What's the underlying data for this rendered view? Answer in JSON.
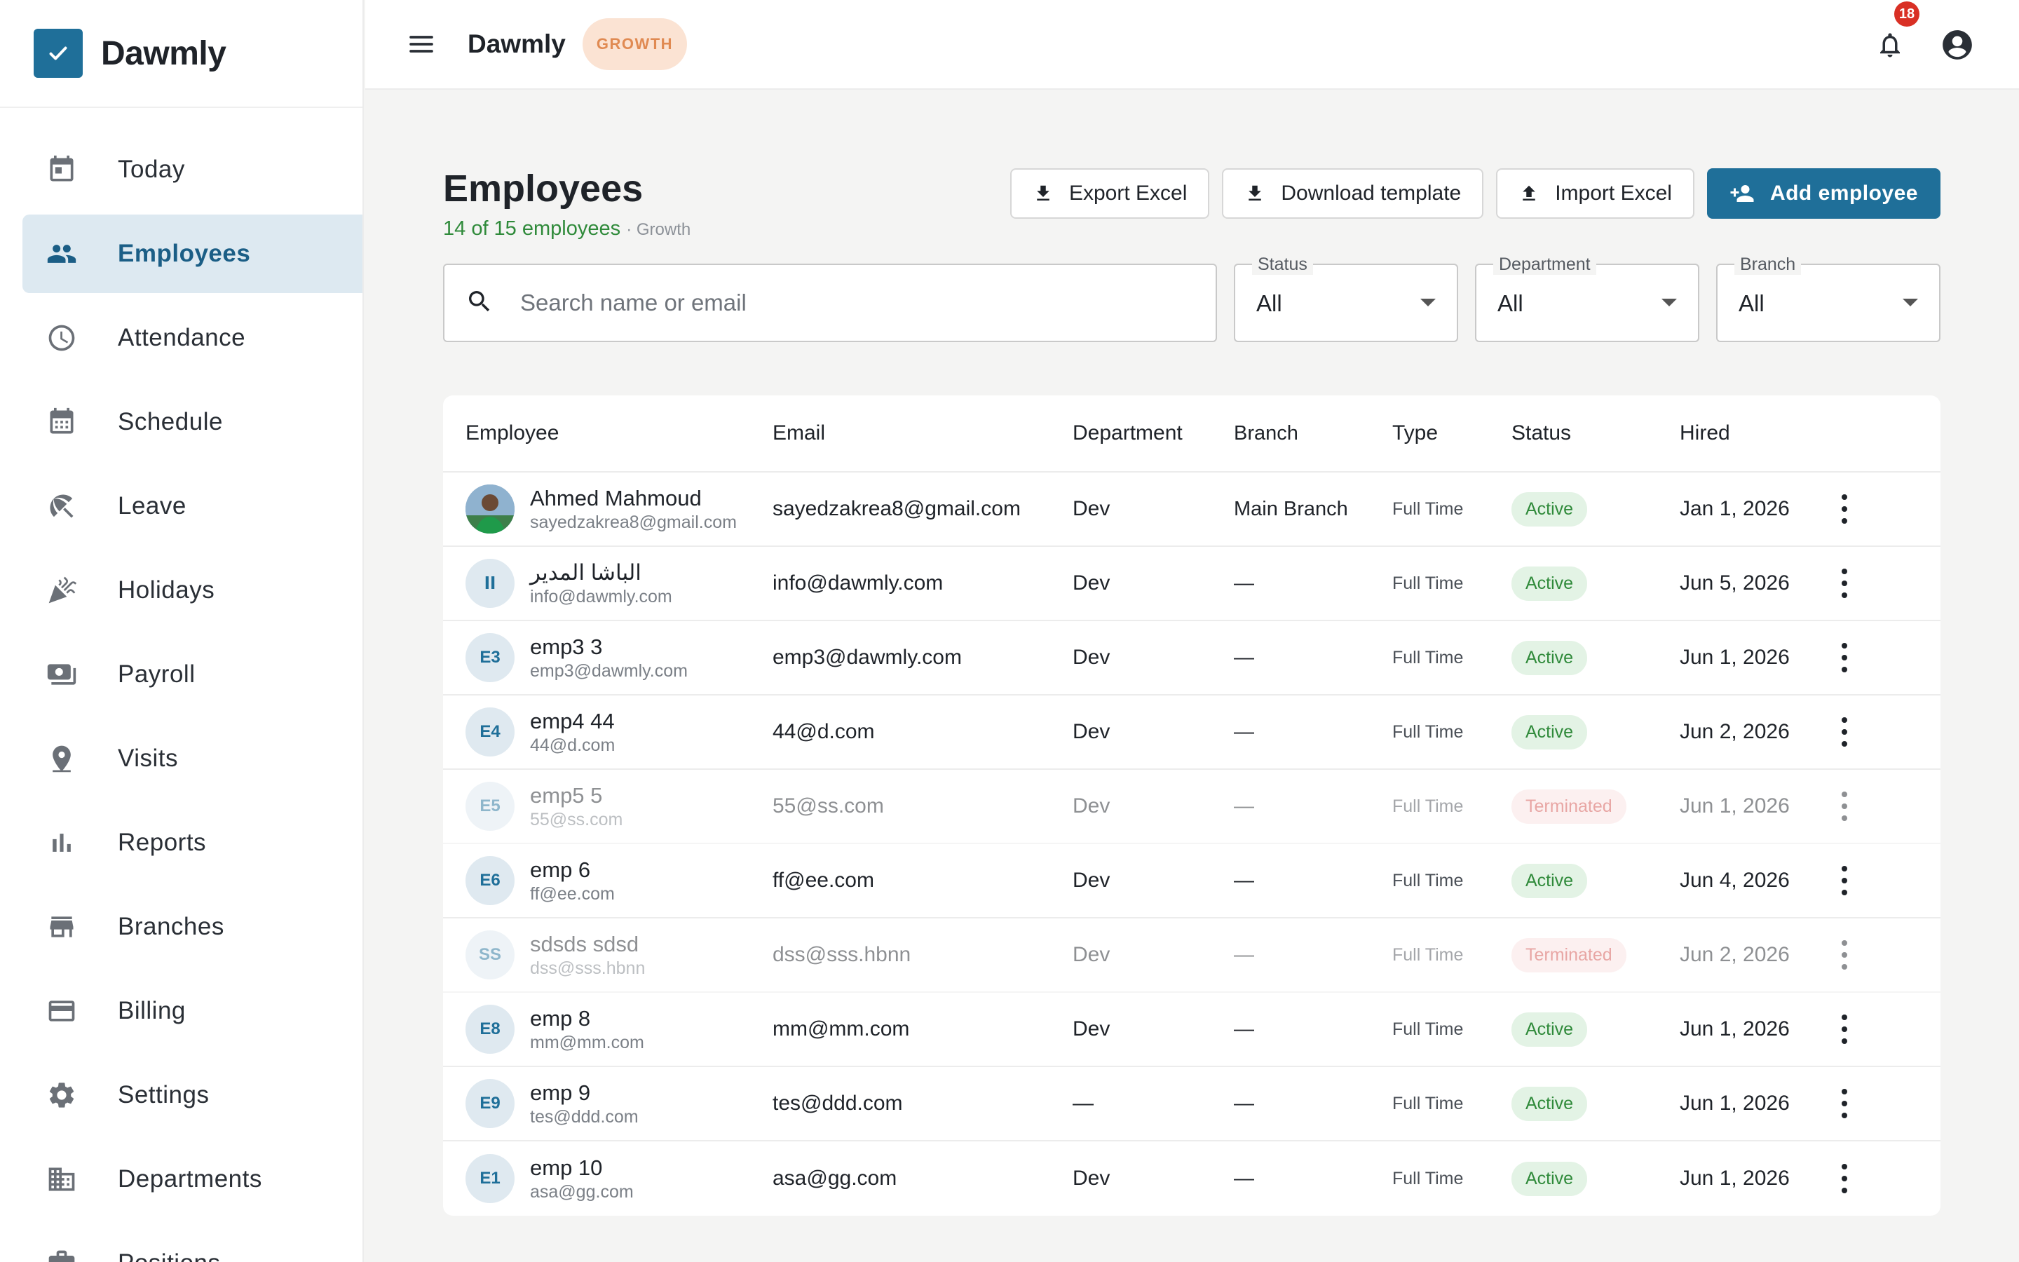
{
  "app": {
    "name": "Dawmly",
    "plan": "GROWTH",
    "notifications": "18"
  },
  "colors": {
    "accent": "#1f6f99",
    "active": "#2f8a3a",
    "terminated": "#d2504c",
    "plan": "#e08a52"
  },
  "sidebar": {
    "items": [
      {
        "label": "Today",
        "icon": "calendar-today-icon"
      },
      {
        "label": "Employees",
        "icon": "people-icon",
        "active": true
      },
      {
        "label": "Attendance",
        "icon": "clock-icon"
      },
      {
        "label": "Schedule",
        "icon": "calendar-grid-icon"
      },
      {
        "label": "Leave",
        "icon": "beach-umbrella-icon"
      },
      {
        "label": "Holidays",
        "icon": "celebration-icon"
      },
      {
        "label": "Payroll",
        "icon": "payments-icon"
      },
      {
        "label": "Visits",
        "icon": "location-pin-icon"
      },
      {
        "label": "Reports",
        "icon": "bar-chart-icon"
      },
      {
        "label": "Branches",
        "icon": "store-icon"
      },
      {
        "label": "Billing",
        "icon": "credit-card-icon"
      },
      {
        "label": "Settings",
        "icon": "gear-icon"
      },
      {
        "label": "Departments",
        "icon": "building-icon"
      },
      {
        "label": "Positions",
        "icon": "briefcase-icon"
      }
    ]
  },
  "page": {
    "title": "Employees",
    "count_text": "14 of 15 employees",
    "plan_text": "· Growth"
  },
  "actions": {
    "export": "Export Excel",
    "template": "Download template",
    "import": "Import Excel",
    "add": "Add employee"
  },
  "filters": {
    "search_placeholder": "Search name or email",
    "status": {
      "label": "Status",
      "value": "All"
    },
    "department": {
      "label": "Department",
      "value": "All"
    },
    "branch": {
      "label": "Branch",
      "value": "All"
    }
  },
  "table": {
    "headers": {
      "employee": "Employee",
      "email": "Email",
      "department": "Department",
      "branch": "Branch",
      "type": "Type",
      "status": "Status",
      "hired": "Hired"
    },
    "rows": [
      {
        "initials": "",
        "photo": true,
        "name": "Ahmed Mahmoud",
        "sub": "sayedzakrea8@gmail.com",
        "email": "sayedzakrea8@gmail.com",
        "department": "Dev",
        "branch": "Main Branch",
        "type": "Full Time",
        "status": "Active",
        "hired": "Jan 1, 2026"
      },
      {
        "initials": "اا",
        "name": "الباشا المدير",
        "sub": "info@dawmly.com",
        "email": "info@dawmly.com",
        "department": "Dev",
        "branch": "—",
        "type": "Full Time",
        "status": "Active",
        "hired": "Jun 5, 2026"
      },
      {
        "initials": "E3",
        "name": "emp3 3",
        "sub": "emp3@dawmly.com",
        "email": "emp3@dawmly.com",
        "department": "Dev",
        "branch": "—",
        "type": "Full Time",
        "status": "Active",
        "hired": "Jun 1, 2026"
      },
      {
        "initials": "E4",
        "name": "emp4 44",
        "sub": "44@d.com",
        "email": "44@d.com",
        "department": "Dev",
        "branch": "—",
        "type": "Full Time",
        "status": "Active",
        "hired": "Jun 2, 2026"
      },
      {
        "initials": "E5",
        "name": "emp5 5",
        "sub": "55@ss.com",
        "email": "55@ss.com",
        "department": "Dev",
        "branch": "—",
        "type": "Full Time",
        "status": "Terminated",
        "hired": "Jun 1, 2026"
      },
      {
        "initials": "E6",
        "name": "emp 6",
        "sub": "ff@ee.com",
        "email": "ff@ee.com",
        "department": "Dev",
        "branch": "—",
        "type": "Full Time",
        "status": "Active",
        "hired": "Jun 4, 2026"
      },
      {
        "initials": "SS",
        "name": "sdsds sdsd",
        "sub": "dss@sss.hbnn",
        "email": "dss@sss.hbnn",
        "department": "Dev",
        "branch": "—",
        "type": "Full Time",
        "status": "Terminated",
        "hired": "Jun 2, 2026"
      },
      {
        "initials": "E8",
        "name": "emp 8",
        "sub": "mm@mm.com",
        "email": "mm@mm.com",
        "department": "Dev",
        "branch": "—",
        "type": "Full Time",
        "status": "Active",
        "hired": "Jun 1, 2026"
      },
      {
        "initials": "E9",
        "name": "emp 9",
        "sub": "tes@ddd.com",
        "email": "tes@ddd.com",
        "department": "—",
        "branch": "—",
        "type": "Full Time",
        "status": "Active",
        "hired": "Jun 1, 2026"
      },
      {
        "initials": "E1",
        "name": "emp 10",
        "sub": "asa@gg.com",
        "email": "asa@gg.com",
        "department": "Dev",
        "branch": "—",
        "type": "Full Time",
        "status": "Active",
        "hired": "Jun 1, 2026"
      }
    ]
  }
}
